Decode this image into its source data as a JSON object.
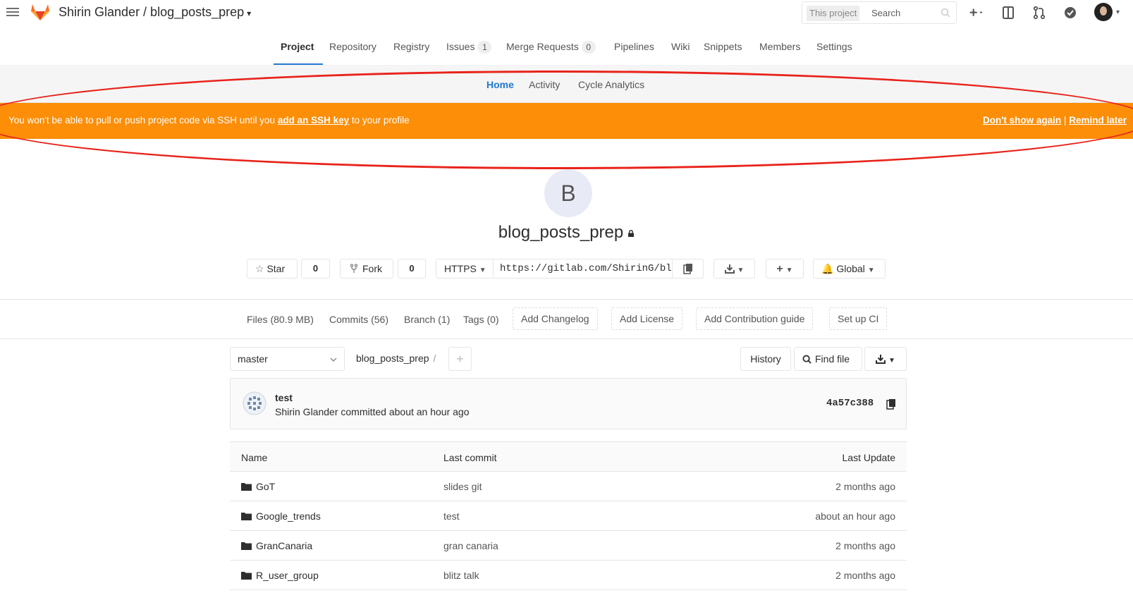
{
  "header": {
    "project_path": "Shirin Glander / blog_posts_prep",
    "search_scope": "This project",
    "search_placeholder": "Search"
  },
  "project_nav": {
    "items": [
      {
        "label": "Project",
        "active": true
      },
      {
        "label": "Repository"
      },
      {
        "label": "Registry"
      },
      {
        "label": "Issues",
        "count": "1"
      },
      {
        "label": "Merge Requests",
        "count": "0"
      },
      {
        "label": "Pipelines"
      },
      {
        "label": "Wiki"
      },
      {
        "label": "Snippets"
      },
      {
        "label": "Members"
      },
      {
        "label": "Settings"
      }
    ]
  },
  "sub_nav": {
    "items": [
      {
        "label": "Home",
        "active": true
      },
      {
        "label": "Activity"
      },
      {
        "label": "Cycle Analytics"
      }
    ]
  },
  "ssh_alert": {
    "text_before": "You won't be able to pull or push project code via SSH until you ",
    "link": "add an SSH key",
    "text_after": " to your profile",
    "dont_show": "Don't show again",
    "separator": "|",
    "remind_later": "Remind later",
    "color": "#fc8e08"
  },
  "project": {
    "avatar_letter": "B",
    "name": "blog_posts_prep",
    "star_label": "Star",
    "star_count": "0",
    "fork_label": "Fork",
    "fork_count": "0",
    "protocol": "HTTPS",
    "clone_url": "https://gitlab.com/ShirinG/blog_posts_prep.git",
    "notification_level": "Global"
  },
  "stats": {
    "files": "Files (80.9 MB)",
    "commits": "Commits (56)",
    "branch": "Branch (1)",
    "tags": "Tags (0)",
    "add_changelog": "Add Changelog",
    "add_license": "Add License",
    "add_contribution": "Add Contribution guide",
    "setup_ci": "Set up CI"
  },
  "tree": {
    "branch": "master",
    "path": "blog_posts_prep",
    "path_sep": "/",
    "history_label": "History",
    "find_file_label": "Find file"
  },
  "last_commit": {
    "title": "test",
    "meta": "Shirin Glander committed about an hour ago",
    "sha": "4a57c388"
  },
  "files": {
    "headers": {
      "name": "Name",
      "last_commit": "Last commit",
      "last_update": "Last Update"
    },
    "rows": [
      {
        "name": "GoT",
        "commit": "slides git",
        "updated": "2 months ago"
      },
      {
        "name": "Google_trends",
        "commit": "test",
        "updated": "about an hour ago"
      },
      {
        "name": "GranCanaria",
        "commit": "gran canaria",
        "updated": "2 months ago"
      },
      {
        "name": "R_user_group",
        "commit": "blitz talk",
        "updated": "2 months ago"
      }
    ]
  },
  "colors": {
    "accent": "#1f78d1",
    "annotation": "#e8231b",
    "gitlab_orange": "#fc6d26"
  }
}
